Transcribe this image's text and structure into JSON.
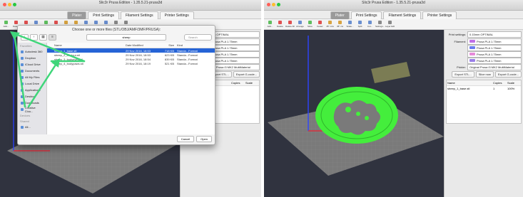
{
  "left": {
    "titles": [
      "Slic3r Prusa Edition - 1.35.5.21-prusa3d",
      "Slic3r Prusa Edition - 1.35.5.21-prusa3d"
    ],
    "tabs": [
      "Plater",
      "Print Settings",
      "Filament Settings",
      "Printer Settings"
    ],
    "toolbar": [
      "Add...",
      "Delete",
      "Delete All",
      "Arrange",
      "More",
      "Fewer",
      "45° ccw",
      "45° cw",
      "Scale...",
      "Split",
      "Cut...",
      "Settings...",
      "Layer Editing"
    ],
    "side": {
      "print_label": "Print settings:",
      "print_value": "0.15mm OPTIMAL",
      "filaments": [
        "Prusa PLA 1.75mm",
        "Prusa PLA 1.75mm",
        "Prusa PLA 1.75mm",
        "Prusa PLA 1.75mm"
      ],
      "printer_value": "Original Prusa i3 MK2 MultiMaterial",
      "buttons": [
        "Export STL...",
        "Export G-code..."
      ],
      "table_header": [
        "Copies",
        "Scale"
      ]
    },
    "dialog": {
      "title": "Choose one or more files (STL/OBJ/AMF/3MF/PRUSA):",
      "folder": "sheep",
      "search": "Search",
      "sidebar": [
        {
          "kind": "head",
          "label": "Favorites"
        },
        {
          "kind": "item",
          "label": "Autodesk 360"
        },
        {
          "kind": "item",
          "label": "Dropbox"
        },
        {
          "kind": "item",
          "label": "iCloud Drive"
        },
        {
          "kind": "item",
          "label": "Documents"
        },
        {
          "kind": "item",
          "label": "All My Files"
        },
        {
          "kind": "item",
          "label": "Local Drive"
        },
        {
          "kind": "item",
          "label": "Applications"
        },
        {
          "kind": "item",
          "label": "Desktop"
        },
        {
          "kind": "item",
          "label": "Downloads"
        },
        {
          "kind": "item",
          "label": "Creative Clou..."
        },
        {
          "kind": "head",
          "label": "Devices"
        },
        {
          "kind": "head",
          "label": "Shared"
        },
        {
          "kind": "item",
          "label": "All..."
        }
      ],
      "columns": [
        "Name",
        "Date Modified",
        "Size",
        "Kind"
      ],
      "files": [
        {
          "name": "sheep_1_base.stl",
          "date": "29 Nov 2016, 18:53",
          "size": "718 KB",
          "kind": "Standa...Format",
          "selected": true
        },
        {
          "name": "sheep_2_contour.stl",
          "date": "29 Nov 2016, 18:53",
          "size": "623 KB",
          "kind": "Standa...Format",
          "selected": false
        },
        {
          "name": "sheep_3_bodyeyes.stl",
          "date": "29 Nov 2016, 18:54",
          "size": "839 KB",
          "kind": "Standa...Format",
          "selected": false
        },
        {
          "name": "sheep_4_bodypaws.stl",
          "date": "29 Nov 2016, 18:19",
          "size": "521 KB",
          "kind": "Standa...Format",
          "selected": false
        }
      ],
      "cancel": "Cancel",
      "open": "Open"
    }
  },
  "right": {
    "titles": [
      "Slic3r Prusa Edition - 1.35.5.21-prusa3d",
      "Slic3r Prusa Edition - 1.35.5.21-prusa3d"
    ],
    "tabs": [
      "Plater",
      "Print Settings",
      "Filament Settings",
      "Printer Settings"
    ],
    "toolbar": [
      "Add...",
      "Delete",
      "Delete All",
      "Arrange",
      "More",
      "Fewer",
      "45° ccw",
      "45° cw",
      "Scale...",
      "Split",
      "Cut...",
      "Settings...",
      "Layer Editing"
    ],
    "side": {
      "print_label": "Print settings:",
      "print_value": "0.15mm OPTIMAL",
      "filament_label": "Filament:",
      "printer_label": "Printer:",
      "filaments": [
        "Prusa PLA 1.75mm",
        "Prusa PLA 1.75mm",
        "Prusa PLA 1.75mm",
        "Prusa PLA 1.75mm"
      ],
      "printer_value": "Original Prusa i3 MK2 MultiMaterial",
      "buttons": [
        "Export STL...",
        "Slice now",
        "Export G-code..."
      ],
      "table_header": [
        "Name",
        "Copies",
        "Scale"
      ],
      "table_row": [
        "sheep_1_base.stl",
        "1",
        "100%"
      ]
    }
  },
  "colors": {
    "scene_bg": "#30333f",
    "bed": "#7c7c7c",
    "model": "#44ee3c",
    "arrow": "#3fd67a",
    "selection": "#2563d6",
    "filament_swatches": [
      "#c070e6",
      "#6b7cf0",
      "#e78ad9",
      "#9a7fe8"
    ]
  }
}
